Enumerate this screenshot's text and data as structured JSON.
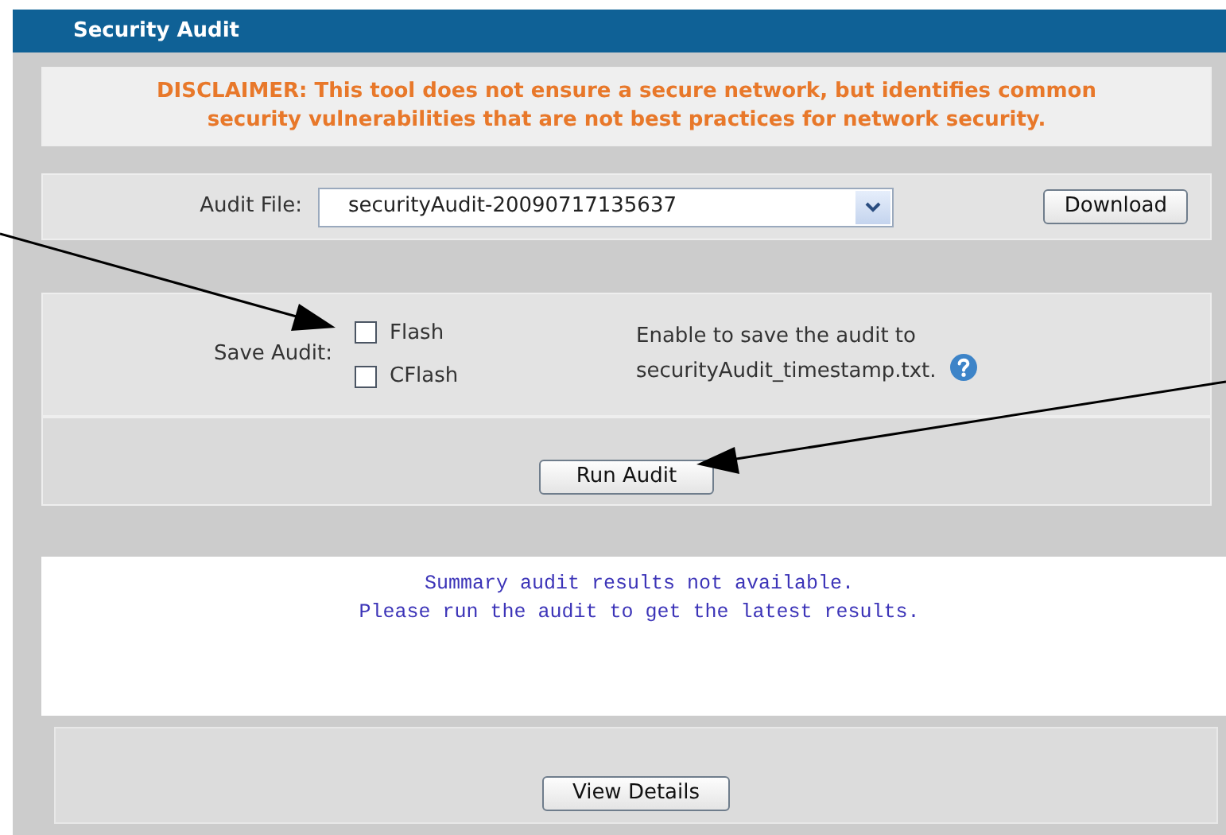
{
  "header": {
    "title": "Security Audit"
  },
  "disclaimer": "DISCLAIMER: This tool does not ensure a secure network, but identifies common security vulnerabilities that are not best practices for network security.",
  "audit_file": {
    "label": "Audit File:",
    "value": "securityAudit-20090717135637",
    "button": "Download"
  },
  "save_audit": {
    "label": "Save Audit:",
    "options": [
      {
        "label": "Flash",
        "checked": false
      },
      {
        "label": "CFlash",
        "checked": false
      }
    ],
    "hint_lines": [
      "Enable to save the audit to",
      "securityAudit_timestamp.txt."
    ]
  },
  "run_button": "Run Audit",
  "summary_lines": [
    "Summary audit results not available.",
    "Please run the audit to get the latest results."
  ],
  "details_button": "View Details"
}
